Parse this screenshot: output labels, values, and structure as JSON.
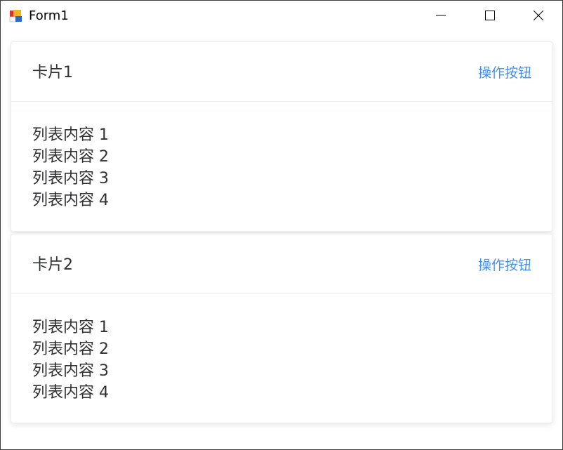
{
  "window": {
    "title": "Form1",
    "controls": {
      "minimize": "minimize-icon",
      "maximize": "maximize-icon",
      "close": "close-icon"
    }
  },
  "cards": [
    {
      "title": "卡片1",
      "action_label": "操作按钮",
      "items": [
        "列表内容 1",
        "列表内容 2",
        "列表内容 3",
        "列表内容 4"
      ]
    },
    {
      "title": "卡片2",
      "action_label": "操作按钮",
      "items": [
        "列表内容 1",
        "列表内容 2",
        "列表内容 3",
        "列表内容 4"
      ]
    }
  ],
  "colors": {
    "accent": "#4a90e2",
    "text": "#303133",
    "divider": "#ebeef5"
  }
}
